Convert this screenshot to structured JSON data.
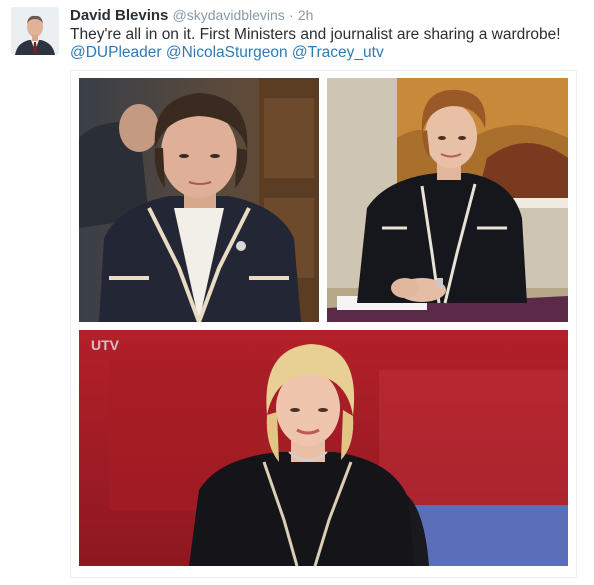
{
  "tweet": {
    "author_name": "David Blevins",
    "author_handle": "@skydavidblevins",
    "separator": "·",
    "timestamp": "2h",
    "text": "They're all in on it. First Ministers and journalist are sharing a wardrobe!",
    "mentions": [
      "@DUPleader",
      "@NicolaSturgeon",
      "@Tracey_utv"
    ]
  },
  "media": {
    "photos": [
      {
        "name": "photo-top-left"
      },
      {
        "name": "photo-top-right"
      },
      {
        "name": "photo-bottom"
      }
    ],
    "channel_logo": "UTV"
  }
}
